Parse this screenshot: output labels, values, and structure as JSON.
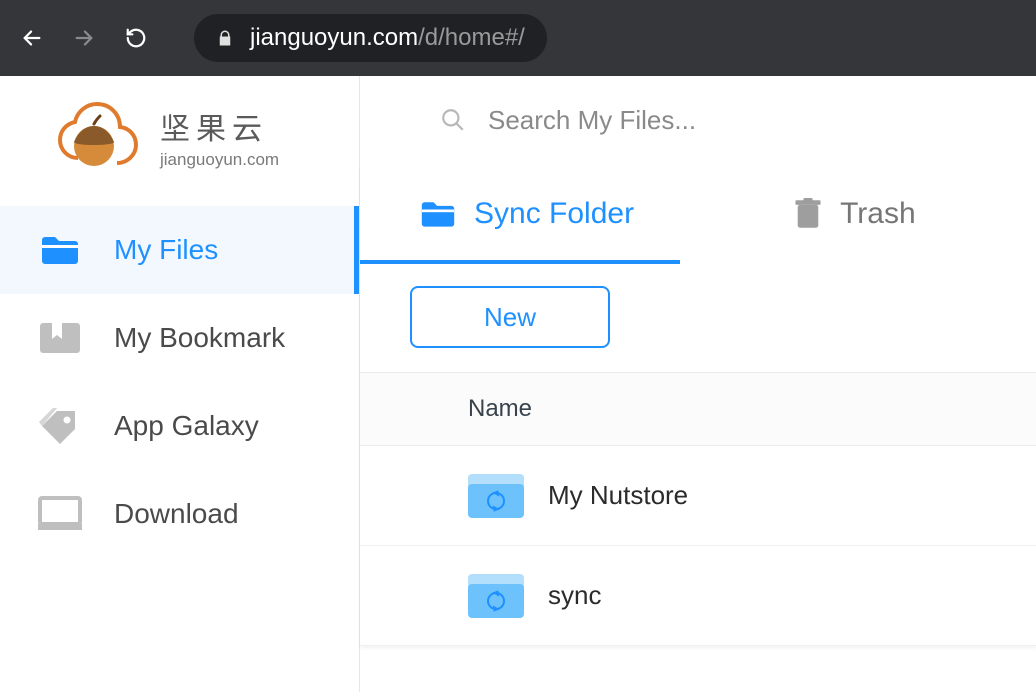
{
  "browser": {
    "url_host": "jianguoyun.com",
    "url_path": "/d/home#/"
  },
  "logo": {
    "cn": "坚果云",
    "en": "jianguoyun.com"
  },
  "sidebar": {
    "items": [
      {
        "label": "My Files",
        "active": true
      },
      {
        "label": "My Bookmark",
        "active": false
      },
      {
        "label": "App Galaxy",
        "active": false
      },
      {
        "label": "Download",
        "active": false
      }
    ]
  },
  "search": {
    "placeholder": "Search My Files..."
  },
  "tabs": {
    "sync": "Sync Folder",
    "trash": "Trash"
  },
  "actions": {
    "new_label": "New"
  },
  "list": {
    "header_name": "Name",
    "rows": [
      {
        "name": "My Nutstore"
      },
      {
        "name": "sync"
      }
    ]
  }
}
